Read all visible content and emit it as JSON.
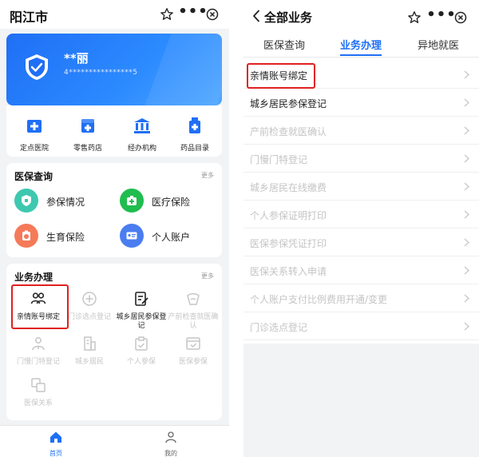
{
  "left": {
    "title": "阳江市",
    "user": {
      "name": "**丽",
      "id": "4****************5"
    },
    "quick": [
      "定点医院",
      "零售药店",
      "经办机构",
      "药品目录"
    ],
    "medical_query": {
      "title": "医保查询",
      "more": "更多",
      "items": [
        "参保情况",
        "医疗保险",
        "生育保险",
        "个人账户"
      ]
    },
    "business": {
      "title": "业务办理",
      "more": "更多",
      "items": [
        "亲情账号绑定",
        "门诊选点登记",
        "城乡居民参保登记",
        "产前检查就医确认",
        "门慢门特登记",
        "城乡居民",
        "个人参保",
        "医保参保",
        "医保关系"
      ]
    },
    "tabbar": {
      "home": "首页",
      "mine": "我的"
    }
  },
  "right": {
    "title": "全部业务",
    "tabs": [
      "医保查询",
      "业务办理",
      "异地就医"
    ],
    "active_tab": "业务办理",
    "rows": [
      {
        "label": "亲情账号绑定",
        "enabled": true
      },
      {
        "label": "城乡居民参保登记",
        "enabled": true
      },
      {
        "label": "产前检查就医确认",
        "enabled": false
      },
      {
        "label": "门慢门特登记",
        "enabled": false
      },
      {
        "label": "城乡居民在线缴费",
        "enabled": false
      },
      {
        "label": "个人参保证明打印",
        "enabled": false
      },
      {
        "label": "医保参保凭证打印",
        "enabled": false
      },
      {
        "label": "医保关系转入申请",
        "enabled": false
      },
      {
        "label": "个人账户支付比例费用开通/变更",
        "enabled": false
      },
      {
        "label": "门诊选点登记",
        "enabled": false
      }
    ]
  },
  "colors": {
    "primary": "#1f6ff5",
    "highlight_box": "#e02020",
    "disabled": "#c4c4c4"
  }
}
